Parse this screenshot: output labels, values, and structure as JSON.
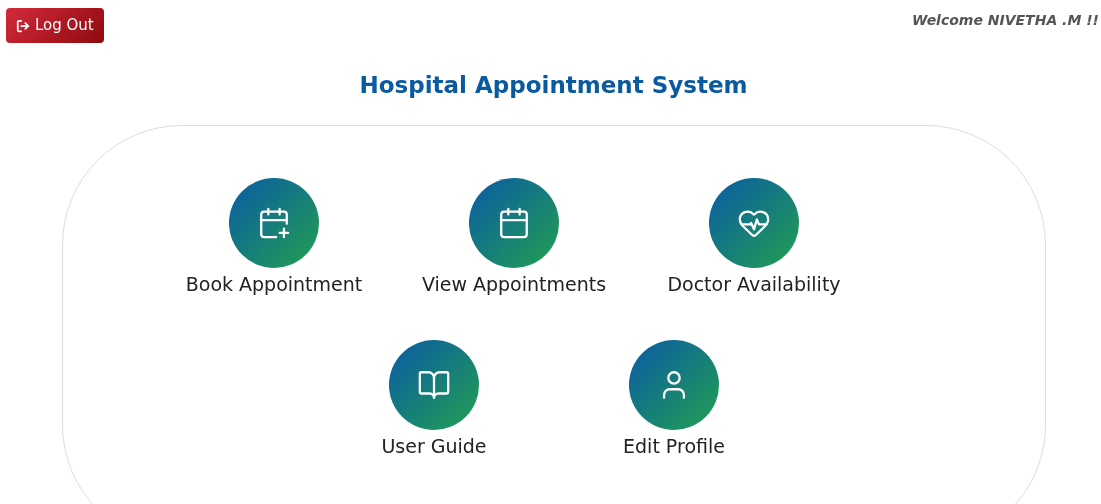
{
  "logout_button": {
    "label": "Log Out"
  },
  "welcome": "Welcome NIVETHA .M !!",
  "title": "Hospital Appointment System",
  "menu_rows": [
    [
      {
        "kind": "calendar-plus",
        "label": "Book Appointment"
      },
      {
        "kind": "calendar",
        "label": "View Appointments"
      },
      {
        "kind": "heart-pulse",
        "label": "Doctor Availability"
      }
    ],
    [
      {
        "kind": "book",
        "label": "User Guide"
      },
      {
        "kind": "user",
        "label": "Edit Profile"
      }
    ]
  ]
}
